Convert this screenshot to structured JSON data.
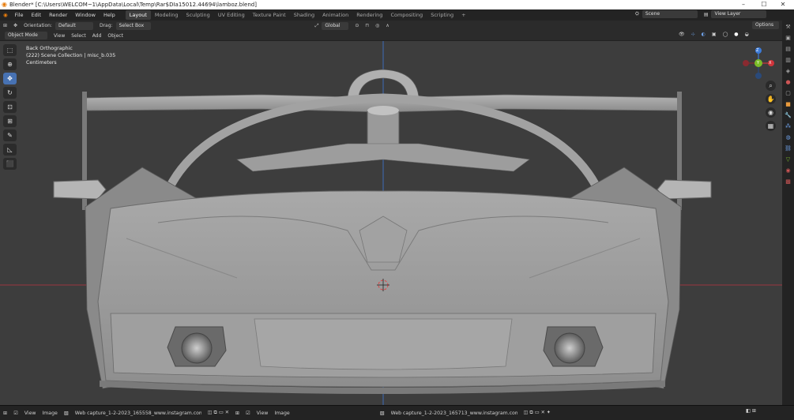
{
  "titlebar": {
    "title": "Blender* [C:\\Users\\WELCOM~1\\AppData\\Local\\Temp\\Rar$DIa15012.44694\\lamboz.blend]",
    "minimize": "–",
    "maximize": "☐",
    "close": "✕"
  },
  "menu": {
    "items": [
      "File",
      "Edit",
      "Render",
      "Window",
      "Help"
    ]
  },
  "workspaces": [
    "Layout",
    "Modeling",
    "Sculpting",
    "UV Editing",
    "Texture Paint",
    "Shading",
    "Animation",
    "Rendering",
    "Compositing",
    "Scripting"
  ],
  "workspace_add": "+",
  "scene": {
    "label": "Scene"
  },
  "view_layer": {
    "label": "View Layer"
  },
  "toolbar": {
    "orientation_label": "Orientation:",
    "orientation_value": "Default",
    "drag_label": "Drag:",
    "drag_value": "Select Box",
    "transform_value": "Global",
    "options_label": "Options"
  },
  "header": {
    "mode": "Object Mode",
    "menus": [
      "View",
      "Select",
      "Add",
      "Object"
    ]
  },
  "viewport": {
    "view_name": "Back Orthographic",
    "collection": "(222) Scene Collection | misc_b.035",
    "units": "Centimeters"
  },
  "gizmo": {
    "x": "X",
    "y": "Y",
    "z": "Z"
  },
  "bottom": {
    "left": {
      "menus": [
        "View",
        "Image"
      ],
      "image": "Web capture_1-2-2023_165558_www.instagram.com.jpeg"
    },
    "right": {
      "menus": [
        "View",
        "Image"
      ],
      "image": "Web capture_1-2-2023_165713_www.instagram.com.jpeg"
    }
  },
  "colors": {
    "viewport_bg": "#3d3d3d",
    "accent": "#4772b3",
    "x_axis": "#d0343b",
    "y_axis": "#7cbd28",
    "z_axis": "#3b7ad8"
  }
}
